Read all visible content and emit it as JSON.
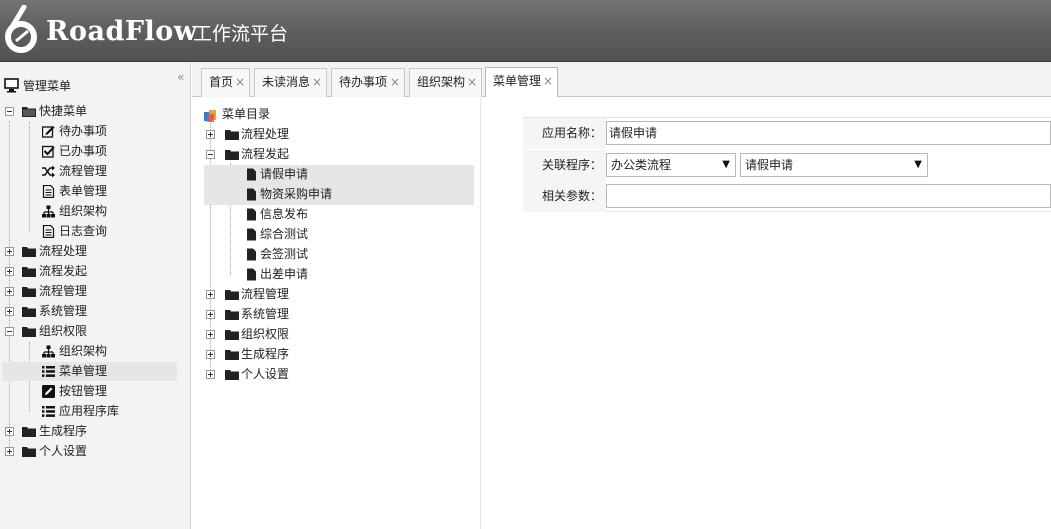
{
  "header": {
    "brand": "RoadFlow",
    "subtitle": "工作流平台"
  },
  "sidebar": {
    "title": "管理菜单",
    "collapse": "«",
    "items": [
      {
        "label": "快捷菜单"
      },
      {
        "label": "待办事项"
      },
      {
        "label": "已办事项"
      },
      {
        "label": "流程管理"
      },
      {
        "label": "表单管理"
      },
      {
        "label": "组织架构"
      },
      {
        "label": "日志查询"
      },
      {
        "label": "流程处理"
      },
      {
        "label": "流程发起"
      },
      {
        "label": "流程管理"
      },
      {
        "label": "系统管理"
      },
      {
        "label": "组织权限"
      },
      {
        "label": "组织架构"
      },
      {
        "label": "菜单管理"
      },
      {
        "label": "按钮管理"
      },
      {
        "label": "应用程序库"
      },
      {
        "label": "生成程序"
      },
      {
        "label": "个人设置"
      }
    ]
  },
  "tabs": [
    {
      "label": "首页",
      "close": "×"
    },
    {
      "label": "未读消息",
      "close": "×"
    },
    {
      "label": "待办事项",
      "close": "×"
    },
    {
      "label": "组织架构",
      "close": "×"
    },
    {
      "label": "菜单管理",
      "close": "×"
    }
  ],
  "menu_tree": {
    "root": "菜单目录",
    "items": [
      {
        "label": "流程处理"
      },
      {
        "label": "流程发起"
      },
      {
        "label": "请假申请"
      },
      {
        "label": "物资采购申请"
      },
      {
        "label": "信息发布"
      },
      {
        "label": "综合测试"
      },
      {
        "label": "会签测试"
      },
      {
        "label": "出差申请"
      },
      {
        "label": "流程管理"
      },
      {
        "label": "系统管理"
      },
      {
        "label": "组织权限"
      },
      {
        "label": "生成程序"
      },
      {
        "label": "个人设置"
      }
    ]
  },
  "form": {
    "app_name_label": "应用名称：",
    "app_name_value": "请假申请",
    "program_label": "关联程序：",
    "program_category": "办公类流程",
    "program_value": "请假申请",
    "params_label": "相关参数：",
    "params_value": "",
    "dropdown_arrow": "▼"
  },
  "colors": {
    "header_bg": "#5e5e5e",
    "selected_row": "#e6e6e6",
    "sidebar_bg": "#f3f3f3"
  }
}
